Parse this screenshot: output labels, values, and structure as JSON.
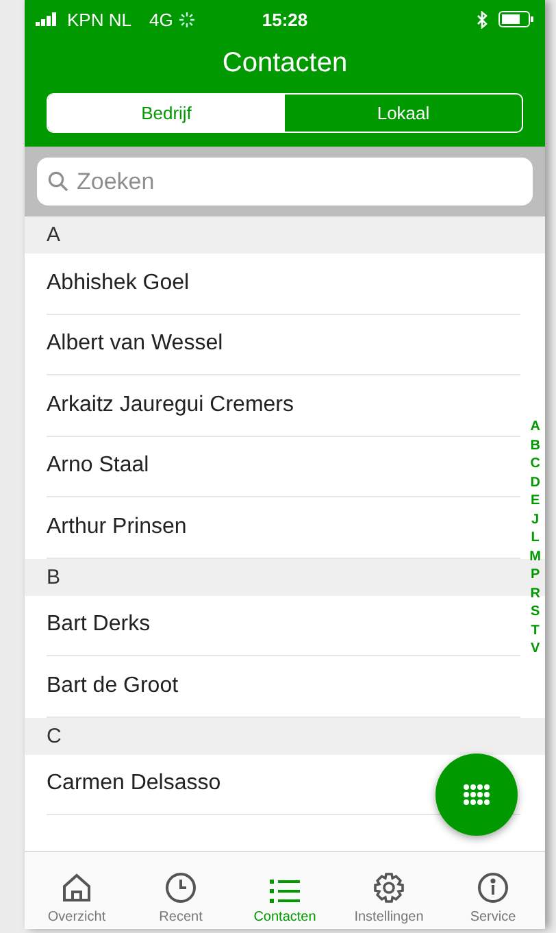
{
  "status_bar": {
    "carrier": "KPN NL",
    "network": "4G",
    "time": "15:28"
  },
  "title": "Contacten",
  "segments": [
    {
      "label": "Bedrijf",
      "selected": true
    },
    {
      "label": "Lokaal",
      "selected": false
    }
  ],
  "search": {
    "placeholder": "Zoeken"
  },
  "sections": [
    {
      "letter": "A",
      "contacts": [
        "Abhishek Goel",
        "Albert van Wessel",
        "Arkaitz Jauregui Cremers",
        "Arno Staal",
        "Arthur Prinsen"
      ]
    },
    {
      "letter": "B",
      "contacts": [
        "Bart Derks",
        "Bart de Groot"
      ]
    },
    {
      "letter": "C",
      "contacts": [
        "Carmen Delsasso"
      ]
    }
  ],
  "index": [
    "A",
    "B",
    "C",
    "D",
    "E",
    "J",
    "L",
    "M",
    "P",
    "R",
    "S",
    "T",
    "V"
  ],
  "tabs": [
    {
      "kind": "home",
      "label": "Overzicht",
      "selected": false
    },
    {
      "kind": "clock",
      "label": "Recent",
      "selected": false
    },
    {
      "kind": "list",
      "label": "Contacten",
      "selected": true
    },
    {
      "kind": "gear",
      "label": "Instellingen",
      "selected": false
    },
    {
      "kind": "info",
      "label": "Service",
      "selected": false
    }
  ]
}
